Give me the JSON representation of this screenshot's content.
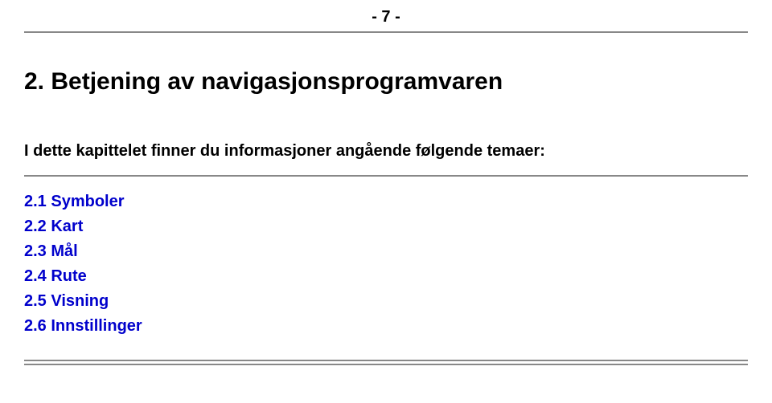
{
  "page_number": "- 7 -",
  "heading": "2. Betjening av navigasjonsprogramvaren",
  "intro": "I dette kapittelet finner du informasjoner angående følgende temaer:",
  "toc": [
    "2.1 Symboler",
    "2.2 Kart",
    "2.3 Mål",
    "2.4 Rute",
    "2.5 Visning",
    "2.6 Innstillinger"
  ]
}
